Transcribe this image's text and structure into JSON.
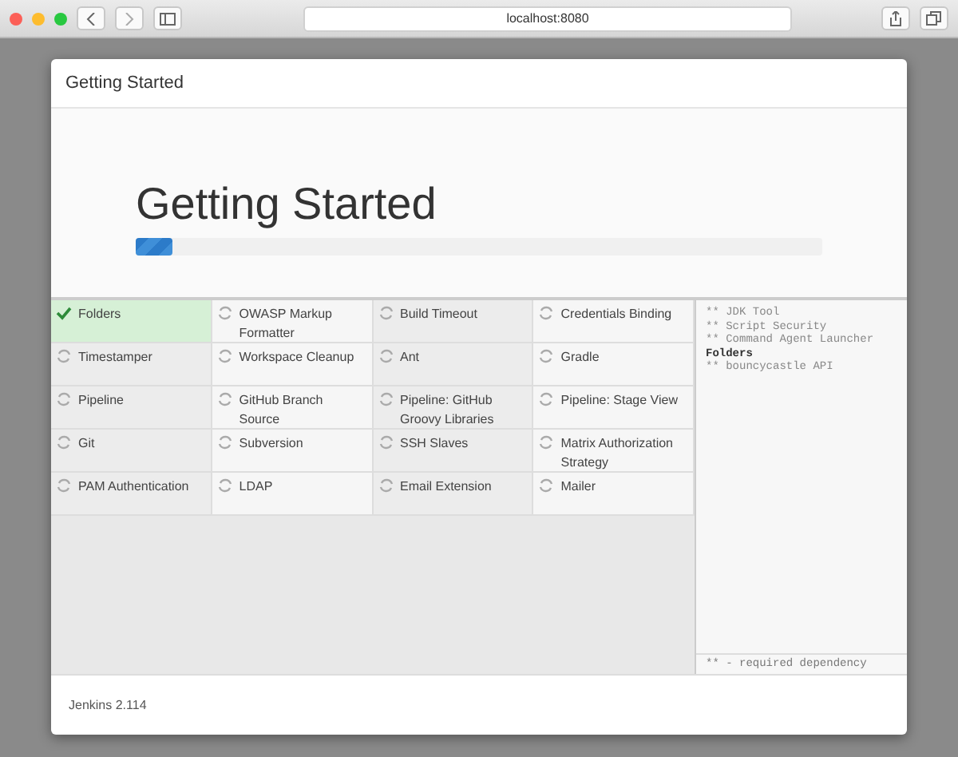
{
  "browser": {
    "address": "localhost:8080"
  },
  "dialog": {
    "header": "Getting Started",
    "title": "Getting Started",
    "progress": {
      "level": 0.053
    }
  },
  "plugins": [
    {
      "name": "Folders",
      "done": true
    },
    {
      "name": "OWASP Markup Formatter",
      "done": false
    },
    {
      "name": "Build Timeout",
      "done": false
    },
    {
      "name": "Credentials Binding",
      "done": false
    },
    {
      "name": "Timestamper",
      "done": false
    },
    {
      "name": "Workspace Cleanup",
      "done": false
    },
    {
      "name": "Ant",
      "done": false
    },
    {
      "name": "Gradle",
      "done": false
    },
    {
      "name": "Pipeline",
      "done": false
    },
    {
      "name": "GitHub Branch Source",
      "done": false
    },
    {
      "name": "Pipeline: GitHub Groovy Libraries",
      "done": false
    },
    {
      "name": "Pipeline: Stage View",
      "done": false
    },
    {
      "name": "Git",
      "done": false
    },
    {
      "name": "Subversion",
      "done": false
    },
    {
      "name": "SSH Slaves",
      "done": false
    },
    {
      "name": "Matrix Authorization Strategy",
      "done": false
    },
    {
      "name": "PAM Authentication",
      "done": false
    },
    {
      "name": "LDAP",
      "done": false
    },
    {
      "name": "Email Extension",
      "done": false
    },
    {
      "name": "Mailer",
      "done": false
    }
  ],
  "log": [
    {
      "text": "** JDK Tool",
      "kind": "dependency"
    },
    {
      "text": "** Script Security",
      "kind": "dependency"
    },
    {
      "text": "** Command Agent Launcher",
      "kind": "dependency"
    },
    {
      "text": "Folders",
      "kind": "plugin"
    },
    {
      "text": "** bouncycastle API",
      "kind": "dependency"
    }
  ],
  "legend": "** - required dependency",
  "footer": "Jenkins 2.114"
}
